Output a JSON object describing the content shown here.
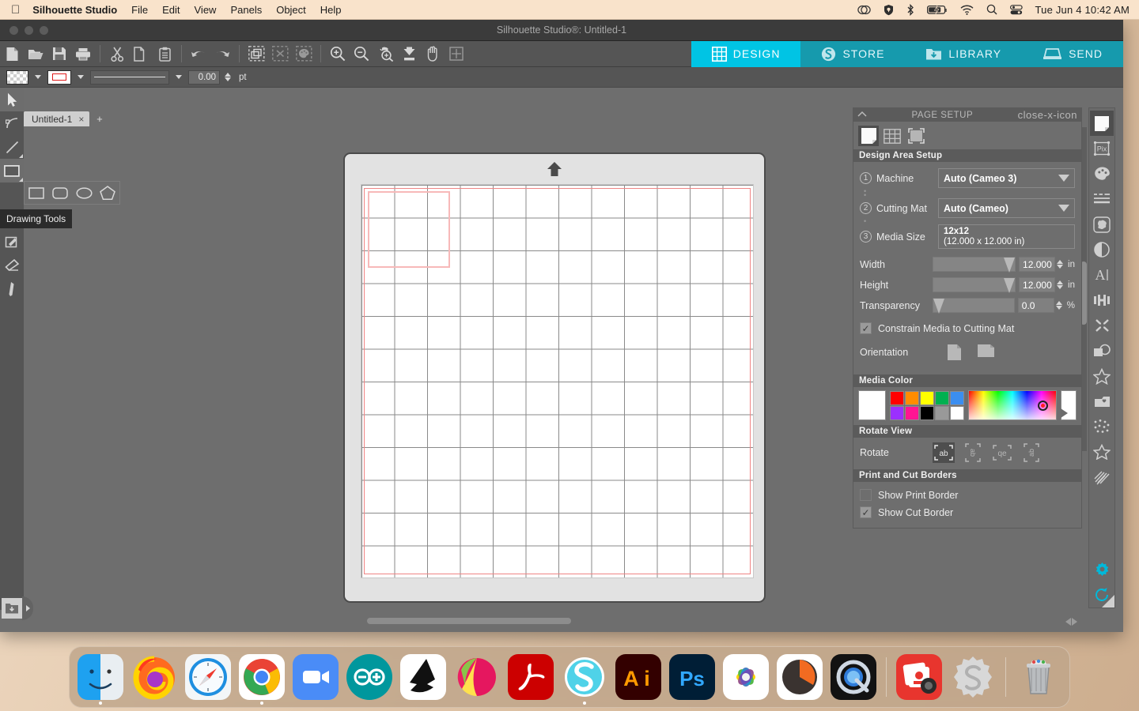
{
  "menubar": {
    "apple_icon": "apple-logo",
    "app_name": "Silhouette Studio",
    "items": [
      "File",
      "Edit",
      "View",
      "Panels",
      "Object",
      "Help"
    ],
    "status_icons": [
      "creative-cloud-icon",
      "shield-icon",
      "bluetooth-icon",
      "battery-charging-icon",
      "wifi-icon",
      "search-icon",
      "control-center-icon"
    ],
    "clock": "Tue Jun 4  10:42 AM"
  },
  "window": {
    "title": "Silhouette Studio®: Untitled-1"
  },
  "toolbar": {
    "file_group": [
      "new-document-icon",
      "open-folder-icon",
      "save-icon",
      "print-icon"
    ],
    "edit_group": [
      "cut-scissors-icon",
      "copy-icon",
      "paste-icon"
    ],
    "history_group": [
      "undo-icon",
      "redo-icon"
    ],
    "select_group": [
      "select-all-icon",
      "deselect-all-icon",
      "select-by-color-icon"
    ],
    "view_group": [
      "zoom-in-icon",
      "zoom-out-icon",
      "zoom-selection-icon",
      "fit-to-page-icon",
      "pan-hand-icon",
      "fit-window-icon"
    ],
    "modes": [
      {
        "label": "DESIGN",
        "icon": "grid-icon",
        "active": true
      },
      {
        "label": "STORE",
        "icon": "store-s-icon",
        "active": false
      },
      {
        "label": "LIBRARY",
        "icon": "library-download-icon",
        "active": false
      },
      {
        "label": "SEND",
        "icon": "cutting-machine-icon",
        "active": false
      }
    ]
  },
  "stylebar": {
    "fill_swatch": "transparent-checker",
    "line_swatch_color": "#e01b1b",
    "line_style": "solid-line",
    "line_weight_value": "0.00",
    "line_weight_unit": "pt"
  },
  "tabs": {
    "documents": [
      {
        "name": "Untitled-1",
        "close": "×"
      }
    ],
    "add_label": "+"
  },
  "tools": {
    "rail": [
      {
        "name": "select-tool",
        "icon": "arrow-cursor-icon",
        "selected": true
      },
      {
        "name": "edit-points-tool",
        "icon": "node-edit-icon",
        "selected": false
      },
      {
        "name": "line-tool",
        "icon": "line-icon",
        "selected": false
      },
      {
        "name": "drawing-tools",
        "icon": "rectangle-icon",
        "selected": true
      },
      {
        "name": "text-tool",
        "icon": "text-a-icon",
        "selected": false
      },
      {
        "name": "sketch-tool",
        "icon": "sketch-pad-icon",
        "selected": false
      },
      {
        "name": "eraser-tool",
        "icon": "eraser-icon",
        "selected": false
      },
      {
        "name": "knife-tool",
        "icon": "knife-icon",
        "selected": false
      }
    ],
    "flyout": [
      {
        "name": "rectangle-tool",
        "icon": "rectangle-icon"
      },
      {
        "name": "rounded-rectangle-tool",
        "icon": "rounded-rectangle-icon"
      },
      {
        "name": "ellipse-tool",
        "icon": "ellipse-icon"
      },
      {
        "name": "polygon-tool",
        "icon": "pentagon-icon"
      }
    ],
    "tooltip": "Drawing Tools"
  },
  "panel": {
    "title": "PAGE SETUP",
    "collapse_icon": "chevron-up-icon",
    "close_icon": "close-x-icon",
    "tabs": [
      {
        "name": "page-tab",
        "icon": "page-icon",
        "active": true
      },
      {
        "name": "grid-tab",
        "icon": "grid-icon",
        "active": false
      },
      {
        "name": "registration-tab",
        "icon": "registration-marks-icon",
        "active": false
      }
    ],
    "design_area": {
      "header": "Design Area Setup",
      "machine": {
        "step": "1",
        "label": "Machine",
        "value": "Auto (Cameo 3)"
      },
      "cutting_mat": {
        "step": "2",
        "label": "Cutting Mat",
        "value": "Auto (Cameo)"
      },
      "media_size": {
        "step": "3",
        "label": "Media Size",
        "value_line1": "12x12",
        "value_line2": "(12.000 x 12.000 in)"
      },
      "width": {
        "label": "Width",
        "value": "12.000",
        "unit": "in"
      },
      "height": {
        "label": "Height",
        "value": "12.000",
        "unit": "in"
      },
      "transparency": {
        "label": "Transparency",
        "value": "0.0",
        "unit": "%"
      },
      "constrain": {
        "label": "Constrain Media to Cutting Mat",
        "checked": true
      },
      "orientation": {
        "label": "Orientation",
        "options": [
          "portrait-icon",
          "landscape-icon"
        ]
      }
    },
    "media_color": {
      "header": "Media Color",
      "selected": "#ffffff",
      "palette": [
        "#ff0000",
        "#ff8c00",
        "#ffff00",
        "#00b050",
        "#3b8ef0",
        "#9b30ff",
        "#ff1493",
        "#000000",
        "#999999",
        "#ffffff"
      ]
    },
    "rotate_view": {
      "header": "Rotate View",
      "label": "Rotate",
      "options": [
        {
          "name": "rotate-0-icon",
          "glyph": "ab",
          "active": true
        },
        {
          "name": "rotate-90-icon",
          "glyph": "ab",
          "active": false
        },
        {
          "name": "rotate-180-icon",
          "glyph": "qe",
          "active": false
        },
        {
          "name": "rotate-270-icon",
          "glyph": "ab",
          "active": false
        }
      ]
    },
    "borders": {
      "header": "Print and Cut Borders",
      "show_print_border": {
        "label": "Show Print Border",
        "checked": false
      },
      "show_cut_border": {
        "label": "Show Cut Border",
        "checked": true
      }
    }
  },
  "right_rail": {
    "icons": [
      {
        "name": "page-setup-icon",
        "active": true
      },
      {
        "name": "pixscan-icon",
        "active": false
      },
      {
        "name": "fill-palette-icon",
        "active": false
      },
      {
        "name": "line-style-icon",
        "active": false
      },
      {
        "name": "trace-icon",
        "active": false
      },
      {
        "name": "offset-icon",
        "active": false
      },
      {
        "name": "text-style-icon",
        "active": false
      },
      {
        "name": "transform-icon",
        "active": false
      },
      {
        "name": "modify-icon",
        "active": false
      },
      {
        "name": "replicate-icon",
        "active": false
      },
      {
        "name": "design-star-icon",
        "active": false
      },
      {
        "name": "my-library-icon",
        "active": false
      },
      {
        "name": "rhinestones-icon",
        "active": false
      },
      {
        "name": "star-outline-icon",
        "active": false
      },
      {
        "name": "sketch-fill-icon",
        "active": false
      },
      {
        "name": "preferences-gear-icon",
        "active": false
      },
      {
        "name": "sync-refresh-icon",
        "active": false
      }
    ]
  },
  "canvas": {
    "mat_label": "cutting-mat",
    "arrow_icon": "mat-load-arrow",
    "grid_columns": 12,
    "grid_rows": 12,
    "shape": "rounded-rectangle-outline"
  },
  "bottom": {
    "library_icon": "library-download-icon",
    "expand_icon": "expand-right-arrow",
    "nav_left": "left-arrow-icon",
    "nav_right": "right-arrow-icon"
  },
  "dock": {
    "apps": [
      {
        "name": "finder",
        "running": true
      },
      {
        "name": "firefox",
        "running": false
      },
      {
        "name": "safari",
        "running": false
      },
      {
        "name": "chrome",
        "running": true
      },
      {
        "name": "zoom",
        "running": false
      },
      {
        "name": "arduino",
        "running": false
      },
      {
        "name": "inkscape",
        "running": false
      },
      {
        "name": "krita",
        "running": false
      },
      {
        "name": "acrobat-reader",
        "running": false
      },
      {
        "name": "silhouette-studio",
        "running": true
      },
      {
        "name": "illustrator",
        "running": false
      },
      {
        "name": "photoshop",
        "running": false
      },
      {
        "name": "photos",
        "running": false
      },
      {
        "name": "keynote",
        "running": false
      },
      {
        "name": "quicktime",
        "running": false
      }
    ],
    "utilities": [
      {
        "name": "screenshot",
        "running": false
      },
      {
        "name": "silhouette-gear",
        "running": false
      }
    ],
    "trash": {
      "name": "trash"
    }
  }
}
